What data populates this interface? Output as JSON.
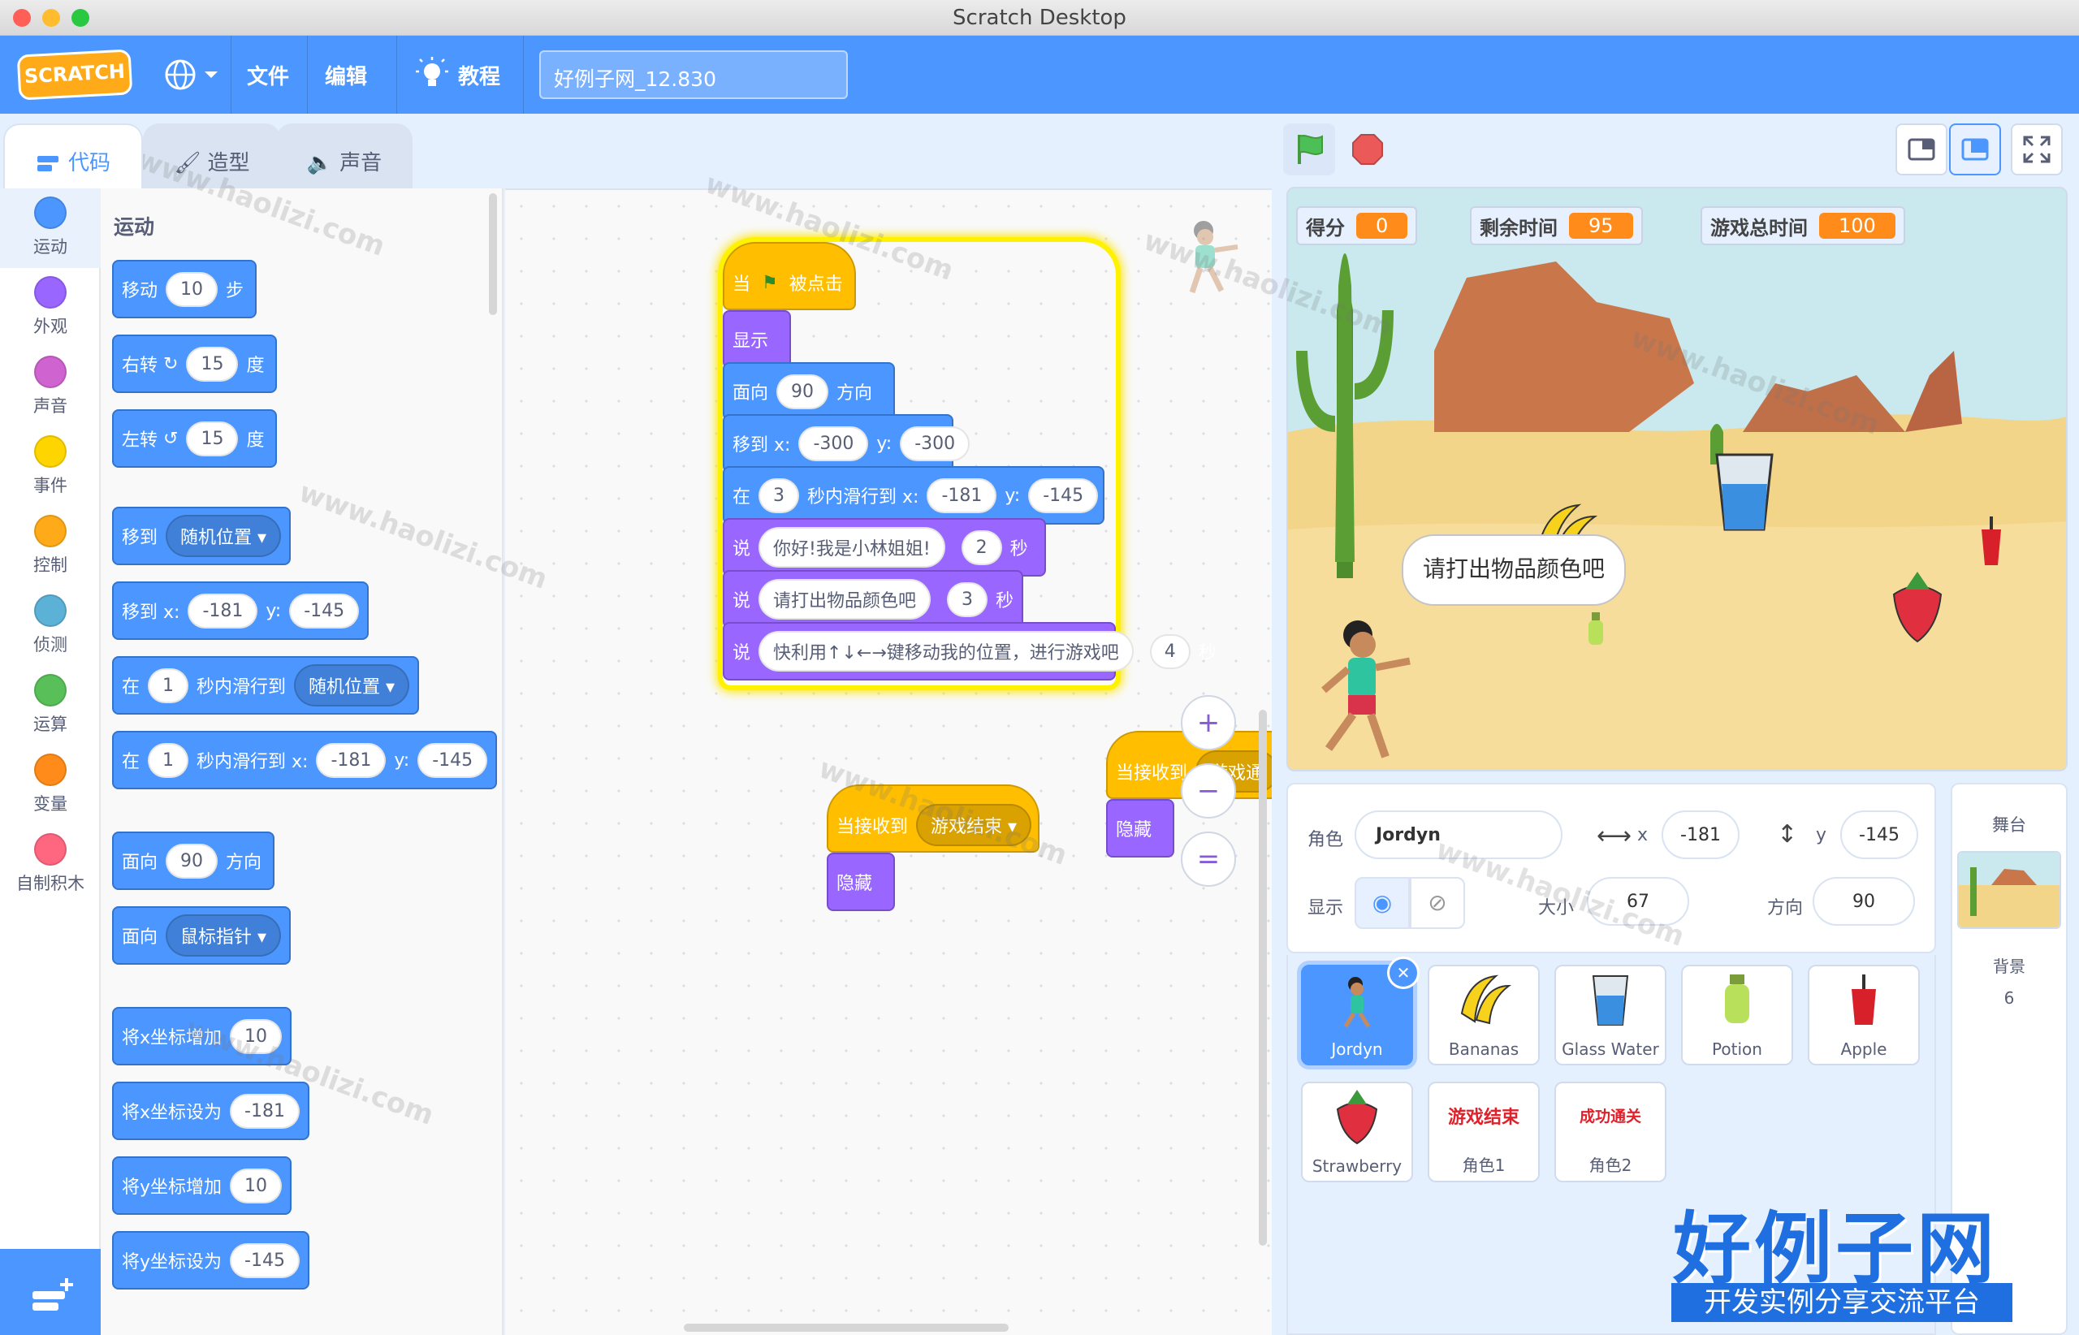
{
  "window": {
    "title": "Scratch Desktop"
  },
  "menu": {
    "logo": "SCRATCH",
    "file": "文件",
    "edit": "编辑",
    "tutorials": "教程",
    "project_title": "好例子网_12.830"
  },
  "tabs": {
    "code": "代码",
    "costumes": "造型",
    "sounds": "声音"
  },
  "categories": [
    {
      "label": "运动",
      "color": "#4c97ff"
    },
    {
      "label": "外观",
      "color": "#9966ff"
    },
    {
      "label": "声音",
      "color": "#cf63cf"
    },
    {
      "label": "事件",
      "color": "#ffd500"
    },
    {
      "label": "控制",
      "color": "#ffab19"
    },
    {
      "label": "侦测",
      "color": "#5cb1d6"
    },
    {
      "label": "运算",
      "color": "#59c059"
    },
    {
      "label": "变量",
      "color": "#ff8c1a"
    },
    {
      "label": "自制积木",
      "color": "#ff6680"
    }
  ],
  "palette": {
    "heading": "运动",
    "move": {
      "a": "移动",
      "v": "10",
      "b": "步"
    },
    "turn_right": {
      "a": "右转",
      "v": "15",
      "b": "度"
    },
    "turn_left": {
      "a": "左转",
      "v": "15",
      "b": "度"
    },
    "goto_random": {
      "a": "移到",
      "dd": "随机位置"
    },
    "goto_xy": {
      "a": "移到 x:",
      "x": "-181",
      "yl": "y:",
      "y": "-145"
    },
    "glide_random": {
      "a": "在",
      "v": "1",
      "b": "秒内滑行到",
      "dd": "随机位置"
    },
    "glide_xy": {
      "a": "在",
      "v": "1",
      "b": "秒内滑行到 x:",
      "x": "-181",
      "yl": "y:",
      "y": "-145"
    },
    "point_dir": {
      "a": "面向",
      "v": "90",
      "b": "方向"
    },
    "point_towards": {
      "a": "面向",
      "dd": "鼠标指针"
    },
    "change_x": {
      "a": "将x坐标增加",
      "v": "10"
    },
    "set_x": {
      "a": "将x坐标设为",
      "v": "-181"
    },
    "change_y": {
      "a": "将y坐标增加",
      "v": "10"
    },
    "set_y": {
      "a": "将y坐标设为",
      "v": "-145"
    }
  },
  "script": {
    "hat": {
      "a": "当",
      "b": "被点击"
    },
    "show": "显示",
    "dir": {
      "a": "面向",
      "v": "90",
      "b": "方向"
    },
    "goto": {
      "a": "移到 x:",
      "x": "-300",
      "yl": "y:",
      "y": "-300"
    },
    "glide": {
      "a": "在",
      "v": "3",
      "b": "秒内滑行到 x:",
      "x": "-181",
      "yl": "y:",
      "y": "-145"
    },
    "say1": {
      "a": "说",
      "msg": "你好!我是小林姐姐!",
      "v": "2",
      "b": "秒"
    },
    "say2": {
      "a": "说",
      "msg": "请打出物品颜色吧",
      "v": "3",
      "b": "秒"
    },
    "say3": {
      "a": "说",
      "msg": "快利用↑↓←→键移动我的位置，进行游戏吧",
      "v": "4",
      "b": "秒"
    },
    "recv1": {
      "a": "当接收到",
      "dd": "游戏结束",
      "hide": "隐藏"
    },
    "recv2": {
      "a": "当接收到",
      "dd": "游戏通",
      "hide": "隐藏"
    }
  },
  "zoom": {
    "in": "+",
    "out": "−",
    "reset": "="
  },
  "stage": {
    "monitors": [
      {
        "label": "得分",
        "value": "0"
      },
      {
        "label": "剩余时间",
        "value": "95"
      },
      {
        "label": "游戏总时间",
        "value": "100"
      }
    ],
    "speech": "请打出物品颜色吧"
  },
  "sprite_info": {
    "sprite_label": "角色",
    "sprite_name": "Jordyn",
    "x_label": "x",
    "x": "-181",
    "y_label": "y",
    "y": "-145",
    "show_label": "显示",
    "size_label": "大小",
    "size": "67",
    "direction_label": "方向",
    "direction": "90"
  },
  "sprites": [
    {
      "name": "Jordyn"
    },
    {
      "name": "Bananas"
    },
    {
      "name": "Glass Water"
    },
    {
      "name": "Potion"
    },
    {
      "name": "Apple"
    },
    {
      "name": "Strawberry"
    },
    {
      "name": "角色1",
      "thumb_text": "游戏结束"
    },
    {
      "name": "角色2",
      "thumb_text": "成功通关"
    }
  ],
  "stage_pane": {
    "title": "舞台",
    "backdrops_label": "背景",
    "backdrops_count": "6"
  },
  "watermark": {
    "text": "www.haolizi.com",
    "brand": "好例子网",
    "slogan": "开发实例分享交流平台"
  }
}
